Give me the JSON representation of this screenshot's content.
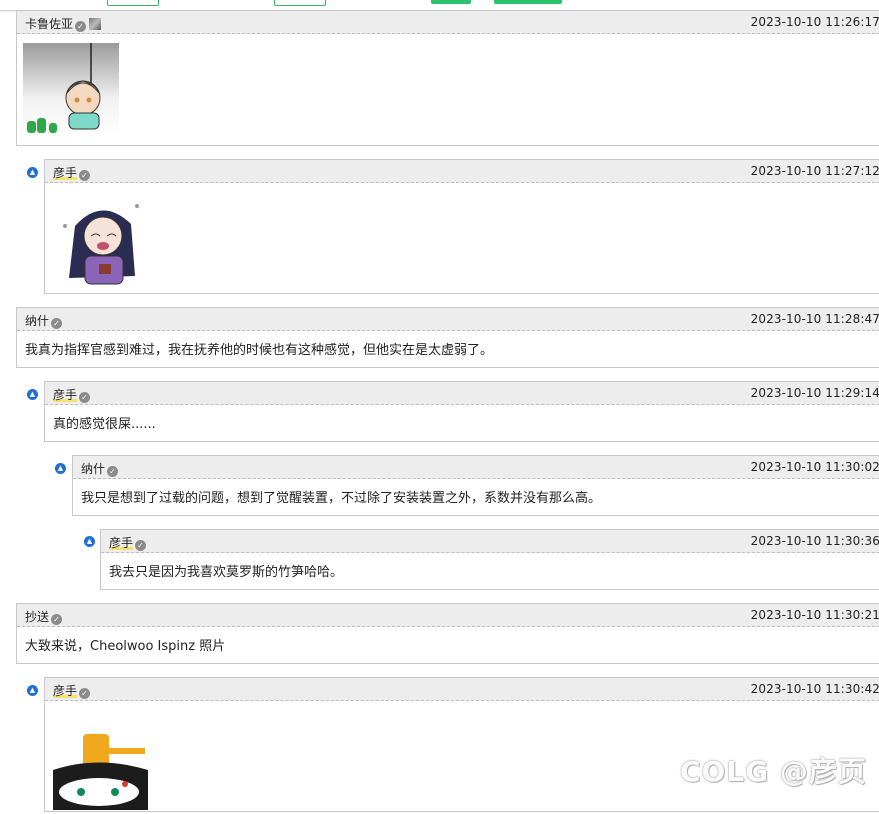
{
  "comments": [
    {
      "author": "卡鲁佐亚",
      "time": "2023-10-10 11:26:17",
      "body": ""
    },
    {
      "author": "彦手",
      "time": "2023-10-10 11:27:12",
      "body": ""
    },
    {
      "author": "纳什",
      "time": "2023-10-10 11:28:47",
      "body": "我真为指挥官感到难过，我在抚养他的时候也有这种感觉，但他实在是太虚弱了。"
    },
    {
      "author": "彦手",
      "time": "2023-10-10 11:29:14",
      "body": "真的感觉很屎......"
    },
    {
      "author": "纳什",
      "time": "2023-10-10 11:30:02",
      "body": "我只是想到了过载的问题，想到了觉醒装置，不过除了安装装置之外，系数并没有那么高。"
    },
    {
      "author": "彦手",
      "time": "2023-10-10 11:30:36",
      "body": "我去只是因为我喜欢莫罗斯的竹笋哈哈。"
    },
    {
      "author": "抄送",
      "time": "2023-10-10 11:30:21",
      "body": "大致来说，Cheolwoo Ispinz 照片"
    },
    {
      "author": "彦手",
      "time": "2023-10-10 11:30:42",
      "body": ""
    }
  ],
  "watermark": "COLG @彦页",
  "icons": {
    "reply": "reply-arrow-icon",
    "verified": "verified-badge-icon"
  },
  "colors": {
    "header_bg": "#ededed",
    "reply_icon": "#1e6fd9",
    "accent_green": "#2dc36d"
  }
}
